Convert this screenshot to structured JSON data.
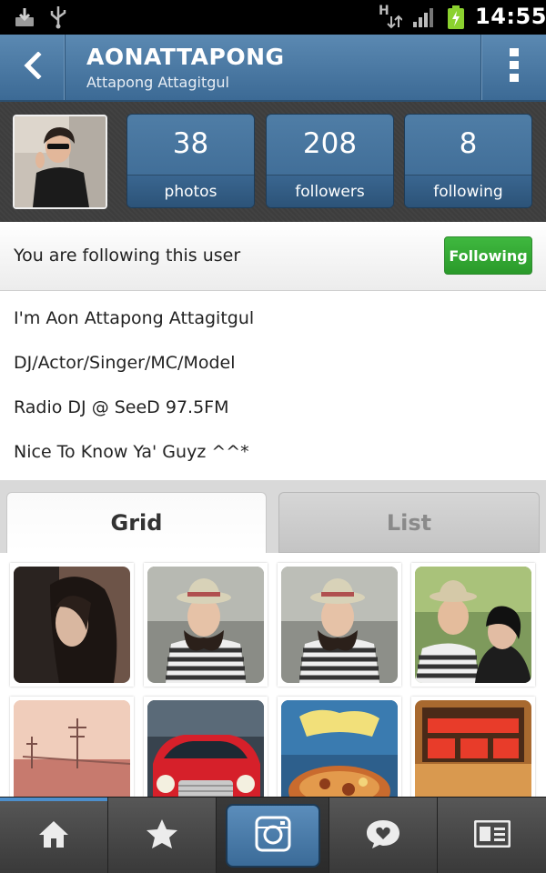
{
  "status_bar": {
    "time": "14:55",
    "network_type": "H",
    "icons": [
      "download-icon",
      "usb-icon",
      "hsdpa-icon",
      "signal-icon",
      "battery-charging-icon"
    ]
  },
  "header": {
    "username": "AONATTAPONG",
    "full_name": "Attapong Attagitgul",
    "back_icon": "chevron-left-icon",
    "menu_icon": "overflow-menu-icon",
    "accent_color": "#4a77a0"
  },
  "stats": {
    "photos": {
      "count": "38",
      "label": "photos"
    },
    "followers": {
      "count": "208",
      "label": "followers"
    },
    "following": {
      "count": "8",
      "label": "following"
    }
  },
  "follow": {
    "status_text": "You are following this user",
    "button_label": "Following",
    "button_color": "#33a833"
  },
  "bio": {
    "lines": [
      "I'm Aon Attapong Attagitgul",
      "DJ/Actor/Singer/MC/Model",
      "Radio DJ @ SeeD 97.5FM",
      "Nice To Know Ya' Guyz ^^*"
    ]
  },
  "tabs": [
    {
      "label": "Grid",
      "active": true
    },
    {
      "label": "List",
      "active": false
    }
  ],
  "bottom_nav": [
    {
      "name": "home",
      "icon": "home-icon",
      "active": true
    },
    {
      "name": "popular",
      "icon": "star-icon",
      "active": false
    },
    {
      "name": "camera",
      "icon": "camera-icon",
      "active": false
    },
    {
      "name": "news",
      "icon": "speech-bubble-heart-icon",
      "active": false
    },
    {
      "name": "profile",
      "icon": "profile-card-icon",
      "active": false
    }
  ]
}
